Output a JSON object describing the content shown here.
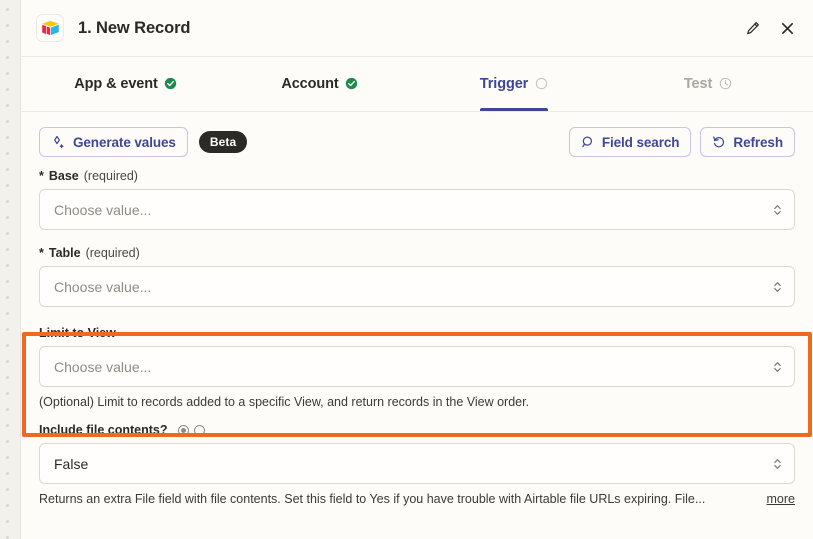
{
  "window": {
    "app_icon": "airtable-icon",
    "title": "1. New Record",
    "edit_icon": "pencil-icon",
    "close_icon": "close-icon"
  },
  "tabs": [
    {
      "label": "App & event",
      "status": "complete",
      "status_icon": "check-circle-icon",
      "active": false,
      "disabled": false
    },
    {
      "label": "Account",
      "status": "complete",
      "status_icon": "check-circle-icon",
      "active": false,
      "disabled": false
    },
    {
      "label": "Trigger",
      "status": "current",
      "status_icon": "empty-circle-icon",
      "active": true,
      "disabled": false
    },
    {
      "label": "Test",
      "status": "pending",
      "status_icon": "clock-icon",
      "active": false,
      "disabled": true
    }
  ],
  "toolbar": {
    "generate_label": "Generate values",
    "generate_icon": "sparkle-icon",
    "beta_badge": "Beta",
    "field_search_label": "Field search",
    "field_search_icon": "search-icon",
    "refresh_label": "Refresh",
    "refresh_icon": "refresh-icon"
  },
  "fields": [
    {
      "name": "base",
      "required_marker": "*",
      "label": "Base",
      "required_note": "(required)",
      "value": "",
      "placeholder": "Choose value...",
      "help": ""
    },
    {
      "name": "table",
      "required_marker": "*",
      "label": "Table",
      "required_note": "(required)",
      "value": "",
      "placeholder": "Choose value...",
      "help": ""
    },
    {
      "name": "limit-to-view",
      "required_marker": "",
      "label": "Limit to View",
      "required_note": "",
      "value": "",
      "placeholder": "Choose value...",
      "help": "(Optional) Limit to records added to a specific View, and return records in the View order.",
      "highlighted": true
    },
    {
      "name": "include-file-contents",
      "required_marker": "",
      "label": "Include file contents?",
      "required_note": "",
      "value": "False",
      "placeholder": "",
      "help": "Returns an extra File field with file contents. Set this field to Yes if you have trouble with Airtable file URLs expiring. File...",
      "more_label": "more",
      "toggles": [
        {
          "name": "toggle-option-1",
          "selected": true
        },
        {
          "name": "toggle-option-2",
          "selected": false
        }
      ]
    }
  ],
  "colors": {
    "accent": "#3f4697",
    "highlight": "#ef6a21",
    "success": "#1b8a4b",
    "background": "#fdfcf9",
    "badge": "#2b2a27"
  }
}
